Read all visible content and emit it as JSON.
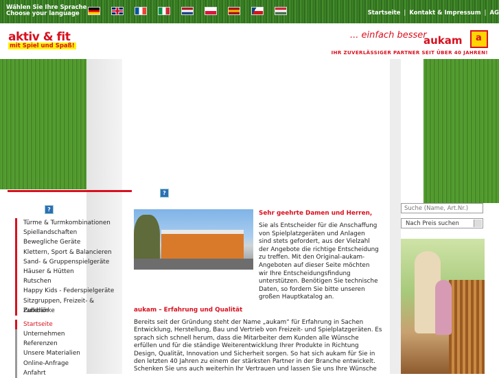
{
  "topbar": {
    "lang_line1": "Wählen Sie Ihre Sprache",
    "lang_line2": "Choose your language",
    "flags": [
      {
        "name": "german",
        "colors": [
          "#000000",
          "#dd0000",
          "#ffce00"
        ],
        "dir": "h"
      },
      {
        "name": "uk",
        "colors": [
          "#012169",
          "#ffffff",
          "#c8102e"
        ],
        "dir": "uk"
      },
      {
        "name": "french",
        "colors": [
          "#0055a4",
          "#ffffff",
          "#ef4135"
        ],
        "dir": "v"
      },
      {
        "name": "italian",
        "colors": [
          "#009246",
          "#ffffff",
          "#ce2b37"
        ],
        "dir": "v"
      },
      {
        "name": "dutch",
        "colors": [
          "#ae1c28",
          "#ffffff",
          "#21468b"
        ],
        "dir": "h"
      },
      {
        "name": "polish",
        "colors": [
          "#ffffff",
          "#dc143c"
        ],
        "dir": "h"
      },
      {
        "name": "spanish",
        "colors": [
          "#aa151b",
          "#f1bf00",
          "#aa151b"
        ],
        "dir": "h"
      },
      {
        "name": "czech",
        "colors": [
          "#ffffff",
          "#d7141a",
          "#11457e"
        ],
        "dir": "cz"
      },
      {
        "name": "hungarian",
        "colors": [
          "#ce2939",
          "#ffffff",
          "#477050"
        ],
        "dir": "h"
      }
    ],
    "links": [
      "Startseite",
      "Kontakt & Impressum",
      "AG"
    ]
  },
  "header": {
    "logo_left": "aktiv & fit",
    "logo_left_sub": "mit Spiel und Spaß!",
    "slogan": "... einfach besser",
    "brand": "aukam",
    "brand_mark": "a",
    "tagline": "IHR ZUVERLÄSSIGER PARTNER SEIT ÜBER 40 JAHREN!"
  },
  "help_icon": "?",
  "nav": {
    "products": [
      "Türme & Turmkombinationen",
      "Spiellandschaften",
      "Bewegliche Geräte",
      "Klettern, Sport & Balancieren",
      "Sand- & Gruppenspielgeräte",
      "Häuser & Hütten",
      "Rutschen",
      "Happy Kids - Federspielgeräte",
      "Sitzgruppen, Freizeit- & Parkbänke",
      "Zubehör"
    ],
    "pages": [
      "Startseite",
      "Unternehmen",
      "Referenzen",
      "Unsere Materialien",
      "Online-Anfrage",
      "Anfahrt"
    ]
  },
  "content": {
    "intro_title": "Sehr geehrte Damen und Herren,",
    "intro_text": "Sie als Entscheider für die Anschaffung von Spielplatzgeräten und Anlagen sind stets gefordert, aus der Vielzahl der Angebote die richtige Entscheidung zu treffen. Mit den Original-aukam-Angeboten auf dieser Seite möchten wir Ihre Entscheidungsfindung unterstützen. Benötigen Sie technische Daten, so fordern Sie bitte unseren großen Hauptkatalog an.",
    "section_title": "aukam – Erfahrung und Qualität",
    "body_text": "Bereits seit der Gründung steht der Name „aukam“ für Erfahrung in Sachen Entwicklung, Herstellung, Bau und Vertrieb von Freizeit- und Spielplatzgeräten. Es sprach sich schnell herum, dass die Mitarbeiter dem Kunden alle Wünsche erfüllen und für die ständige Weiterentwicklung Ihrer Produkte in Richtung Design, Qualität, Innovation und Sicherheit sorgen. So hat sich aukam für Sie in den letzten 40 Jahren zu einem der stärksten Partner in der Branche entwickelt.",
    "body_text_2": "Schenken Sie uns auch weiterhin Ihr Vertrauen und lassen Sie uns Ihre Wünsche"
  },
  "sidebar_right": {
    "search_placeholder": "Suche (Name, Art.Nr.)",
    "price_search": "Nach Preis suchen"
  },
  "colors": {
    "accent": "#d8101e",
    "grass": "#4a8f2b"
  }
}
